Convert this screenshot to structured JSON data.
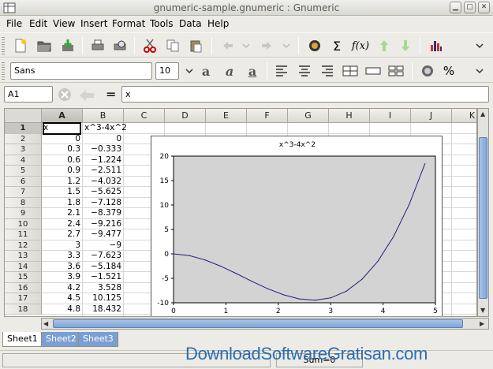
{
  "window": {
    "title": "gnumeric-sample.gnumeric : Gnumeric"
  },
  "menu": [
    "File",
    "Edit",
    "View",
    "Insert",
    "Format",
    "Tools",
    "Data",
    "Help"
  ],
  "toolbar": {
    "icons": [
      "new-icon",
      "open-icon",
      "save-icon",
      "print-icon",
      "print-preview-icon",
      "cut-icon",
      "copy-icon",
      "paste-icon",
      "undo-icon",
      "redo-icon",
      "hyperlink-icon",
      "sum-icon",
      "function-icon",
      "sort-ascending-icon",
      "sort-descending-icon",
      "chart-icon"
    ],
    "function_label": "f(x)",
    "sum_label": "Σ"
  },
  "format_toolbar": {
    "font": "Sans",
    "size": "10",
    "percent_label": "%"
  },
  "formula_bar": {
    "name": "A1",
    "equals": "=",
    "content": "x"
  },
  "columns": [
    "A",
    "B",
    "C",
    "D",
    "E",
    "F",
    "G",
    "H",
    "I",
    "J",
    "K"
  ],
  "rows": [
    "1",
    "2",
    "3",
    "4",
    "5",
    "6",
    "7",
    "8",
    "9",
    "10",
    "11",
    "12",
    "13",
    "14",
    "15",
    "16",
    "17",
    "18"
  ],
  "cells": [
    [
      "x",
      "x^3-4x^2"
    ],
    [
      "0",
      "0"
    ],
    [
      "0.3",
      "−0.333"
    ],
    [
      "0.6",
      "−1.224"
    ],
    [
      "0.9",
      "−2.511"
    ],
    [
      "1.2",
      "−4.032"
    ],
    [
      "1.5",
      "−5.625"
    ],
    [
      "1.8",
      "−7.128"
    ],
    [
      "2.1",
      "−8.379"
    ],
    [
      "2.4",
      "−9.216"
    ],
    [
      "2.7",
      "−9.477"
    ],
    [
      "3",
      "−9"
    ],
    [
      "3.3",
      "−7.623"
    ],
    [
      "3.6",
      "−5.184"
    ],
    [
      "3.9",
      "−1.521"
    ],
    [
      "4.2",
      "3.528"
    ],
    [
      "4.5",
      "10.125"
    ],
    [
      "4.8",
      "18.432"
    ]
  ],
  "chart_data": {
    "type": "line",
    "title": "x^3-4x^2",
    "xlim": [
      0,
      5
    ],
    "ylim": [
      -10,
      20
    ],
    "xticks": [
      "0",
      "1",
      "2",
      "3",
      "4",
      "5"
    ],
    "yticks": [
      "20",
      "15",
      "10",
      "5",
      "0",
      "-5",
      "-10"
    ],
    "x": [
      0,
      0.3,
      0.6,
      0.9,
      1.2,
      1.5,
      1.8,
      2.1,
      2.4,
      2.7,
      3,
      3.3,
      3.6,
      3.9,
      4.2,
      4.5,
      4.8
    ],
    "series": [
      {
        "values": [
          0,
          -0.333,
          -1.224,
          -2.511,
          -4.032,
          -5.625,
          -7.128,
          -8.379,
          -9.216,
          -9.477,
          -9,
          -7.623,
          -5.184,
          -1.521,
          3.528,
          10.125,
          18.432
        ]
      }
    ],
    "plot_background": "#d3d3d3",
    "line_color": "#1f1f7a"
  },
  "sheets": [
    "Sheet1",
    "Sheet2",
    "Sheet3"
  ],
  "status": {
    "sum": "Sum=0"
  },
  "watermark": "DownloadSoftwareGratisan.com"
}
